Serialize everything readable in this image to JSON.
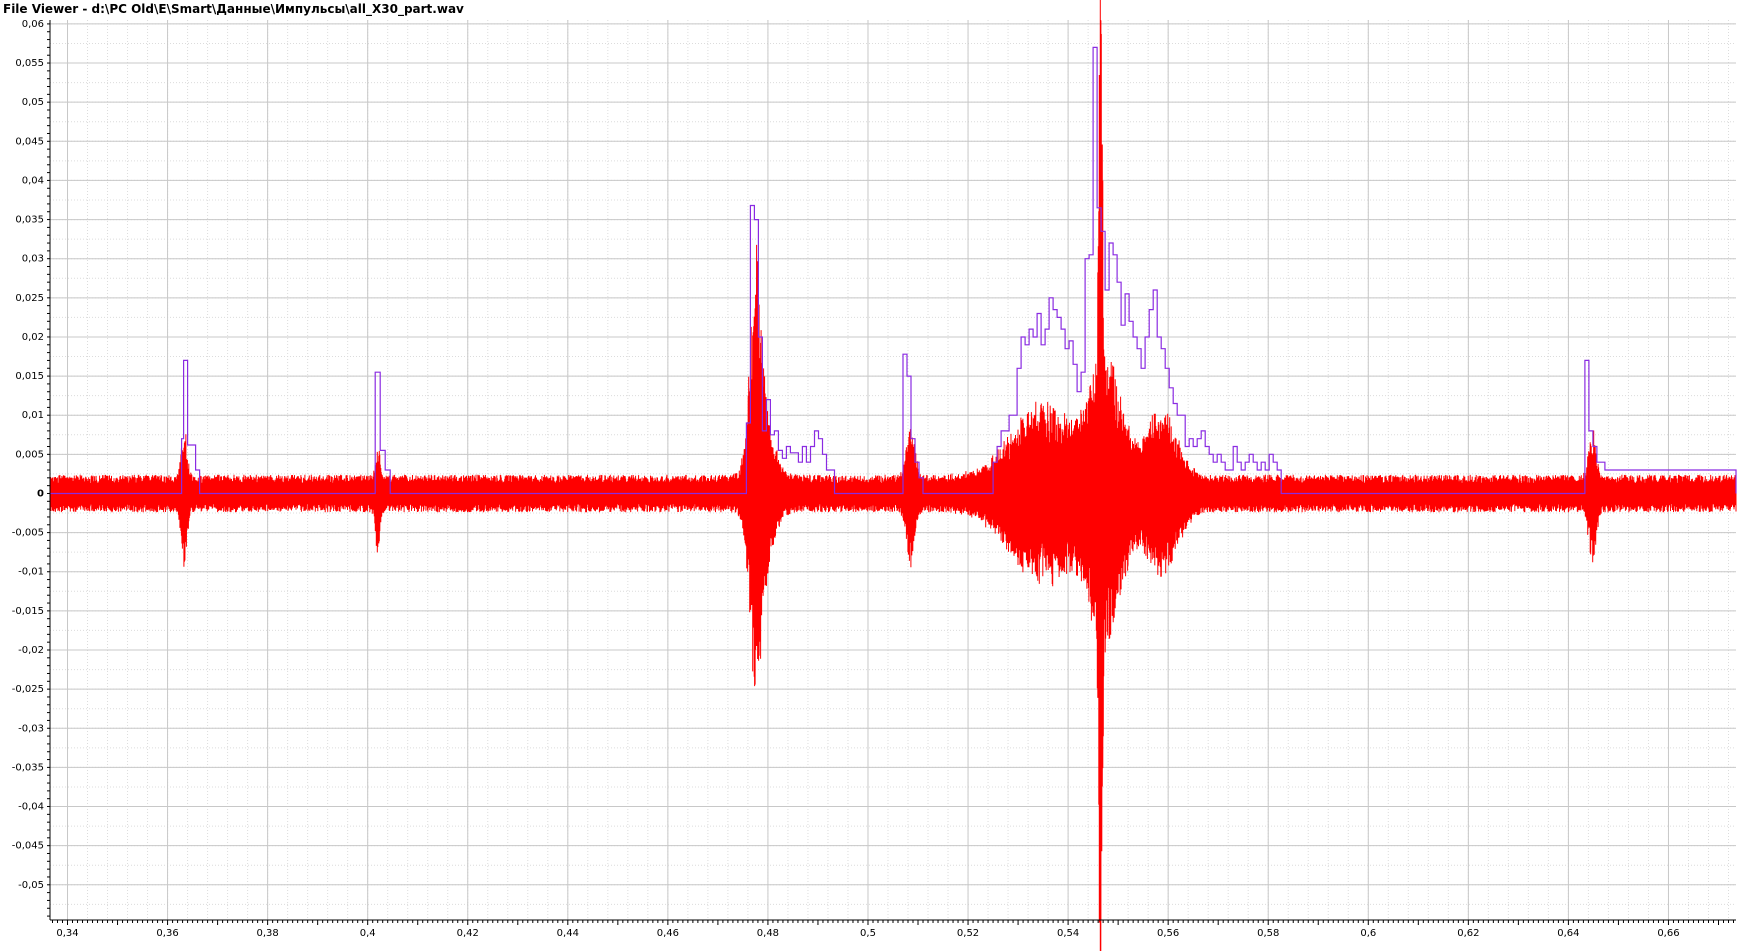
{
  "window": {
    "title": "File Viewer - d:\\PC Old\\E\\Smart\\Данные\\Импульсы\\all_X30_part.wav"
  },
  "colors": {
    "signal": "#ff0000",
    "envelope": "#8a2be2",
    "grid": "#c8c8c8",
    "axis": "#000000",
    "background": "#ffffff"
  },
  "chart_data": {
    "type": "line",
    "grid": true,
    "xlim": [
      0.3365,
      0.6735
    ],
    "ylim": [
      -0.0545,
      0.0605
    ],
    "x_ticks": [
      {
        "value": 0.34,
        "label": "0,34"
      },
      {
        "value": 0.36,
        "label": "0,36"
      },
      {
        "value": 0.38,
        "label": "0,38"
      },
      {
        "value": 0.4,
        "label": "0,4"
      },
      {
        "value": 0.42,
        "label": "0,42"
      },
      {
        "value": 0.44,
        "label": "0,44"
      },
      {
        "value": 0.46,
        "label": "0,46"
      },
      {
        "value": 0.48,
        "label": "0,48"
      },
      {
        "value": 0.5,
        "label": "0,5"
      },
      {
        "value": 0.52,
        "label": "0,52"
      },
      {
        "value": 0.54,
        "label": "0,54"
      },
      {
        "value": 0.56,
        "label": "0,56"
      },
      {
        "value": 0.58,
        "label": "0,58"
      },
      {
        "value": 0.6,
        "label": "0,6"
      },
      {
        "value": 0.62,
        "label": "0,62"
      },
      {
        "value": 0.64,
        "label": "0,64"
      },
      {
        "value": 0.66,
        "label": "0,66"
      }
    ],
    "y_ticks": [
      {
        "value": 0.06,
        "label": "0,06"
      },
      {
        "value": 0.055,
        "label": "0,055"
      },
      {
        "value": 0.05,
        "label": "0,05"
      },
      {
        "value": 0.045,
        "label": "0,045"
      },
      {
        "value": 0.04,
        "label": "0,04"
      },
      {
        "value": 0.035,
        "label": "0,035"
      },
      {
        "value": 0.03,
        "label": "0,03"
      },
      {
        "value": 0.025,
        "label": "0,025"
      },
      {
        "value": 0.02,
        "label": "0,02"
      },
      {
        "value": 0.015,
        "label": "0,015"
      },
      {
        "value": 0.01,
        "label": "0,01"
      },
      {
        "value": 0.005,
        "label": "0,005"
      },
      {
        "value": 0.0,
        "label": "0"
      },
      {
        "value": -0.005,
        "label": "-0,005"
      },
      {
        "value": -0.01,
        "label": "-0,01"
      },
      {
        "value": -0.015,
        "label": "-0,015"
      },
      {
        "value": -0.02,
        "label": "-0,02"
      },
      {
        "value": -0.025,
        "label": "-0,025"
      },
      {
        "value": -0.03,
        "label": "-0,03"
      },
      {
        "value": -0.035,
        "label": "-0,035"
      },
      {
        "value": -0.04,
        "label": "-0,04"
      },
      {
        "value": -0.045,
        "label": "-0,045"
      },
      {
        "value": -0.05,
        "label": "-0,05"
      }
    ],
    "series": [
      {
        "key": "envelope",
        "style": "step",
        "x": [
          0.3365,
          0.3628,
          0.3632,
          0.364,
          0.3648,
          0.3656,
          0.3664,
          0.4015,
          0.4025,
          0.4035,
          0.4045,
          0.4757,
          0.4765,
          0.4773,
          0.4781,
          0.4789,
          0.4797,
          0.4805,
          0.4813,
          0.4821,
          0.4829,
          0.4837,
          0.4845,
          0.4853,
          0.4861,
          0.4869,
          0.4877,
          0.4885,
          0.4893,
          0.4901,
          0.4909,
          0.4917,
          0.4925,
          0.4933,
          0.507,
          0.5078,
          0.5086,
          0.5094,
          0.5102,
          0.511,
          0.525,
          0.5258,
          0.5266,
          0.5274,
          0.5282,
          0.529,
          0.5298,
          0.5306,
          0.5314,
          0.5322,
          0.533,
          0.5338,
          0.5346,
          0.5354,
          0.5362,
          0.537,
          0.5378,
          0.5386,
          0.5394,
          0.5402,
          0.541,
          0.5418,
          0.5426,
          0.5434,
          0.5442,
          0.545,
          0.5458,
          0.5466,
          0.5474,
          0.5482,
          0.549,
          0.5498,
          0.5506,
          0.5514,
          0.5522,
          0.553,
          0.5538,
          0.5546,
          0.5554,
          0.5562,
          0.557,
          0.5578,
          0.5586,
          0.5594,
          0.5602,
          0.561,
          0.5618,
          0.5626,
          0.5634,
          0.5642,
          0.565,
          0.5658,
          0.5666,
          0.5674,
          0.5682,
          0.569,
          0.5698,
          0.5706,
          0.5714,
          0.5722,
          0.573,
          0.5738,
          0.5746,
          0.5754,
          0.5762,
          0.577,
          0.5778,
          0.5786,
          0.5794,
          0.5802,
          0.581,
          0.5818,
          0.5826,
          0.6433,
          0.6441,
          0.6449,
          0.6457,
          0.6465,
          0.6473,
          0.6735
        ],
        "y": [
          0.0,
          0.007,
          0.017,
          0.0062,
          0.0062,
          0.003,
          0.0,
          0.0155,
          0.0055,
          0.003,
          0.0,
          0.009,
          0.0368,
          0.035,
          0.02,
          0.008,
          0.012,
          0.0075,
          0.008,
          0.0055,
          0.0045,
          0.006,
          0.0052,
          0.0052,
          0.004,
          0.006,
          0.004,
          0.006,
          0.008,
          0.007,
          0.005,
          0.003,
          0.003,
          0.0,
          0.0178,
          0.015,
          0.007,
          0.004,
          0.002,
          0.0,
          0.004,
          0.006,
          0.008,
          0.008,
          0.01,
          0.01,
          0.016,
          0.02,
          0.019,
          0.021,
          0.02,
          0.023,
          0.019,
          0.021,
          0.025,
          0.0235,
          0.0225,
          0.021,
          0.0185,
          0.0195,
          0.0165,
          0.013,
          0.0155,
          0.03,
          0.0305,
          0.057,
          0.0365,
          0.0335,
          0.026,
          0.032,
          0.0305,
          0.027,
          0.0215,
          0.0255,
          0.022,
          0.02,
          0.0185,
          0.016,
          0.02,
          0.0235,
          0.026,
          0.02,
          0.0185,
          0.016,
          0.0135,
          0.0115,
          0.01,
          0.01,
          0.006,
          0.007,
          0.006,
          0.007,
          0.008,
          0.006,
          0.005,
          0.004,
          0.005,
          0.004,
          0.003,
          0.003,
          0.006,
          0.004,
          0.003,
          0.004,
          0.005,
          0.004,
          0.003,
          0.004,
          0.003,
          0.005,
          0.004,
          0.003,
          0.0,
          0.017,
          0.008,
          0.006,
          0.004,
          0.004,
          0.003,
          0.0
        ]
      },
      {
        "key": "signal",
        "style": "waveform",
        "noise_amplitude": 0.0024,
        "bursts": [
          {
            "x": 0.3633,
            "pos": 0.0065,
            "neg": 0.0075,
            "width": 0.0008
          },
          {
            "x": 0.402,
            "pos": 0.0045,
            "neg": 0.007,
            "width": 0.0006
          },
          {
            "x": 0.4775,
            "pos": 0.0235,
            "neg": 0.0185,
            "width": 0.0016
          },
          {
            "x": 0.479,
            "pos": 0.008,
            "neg": 0.008,
            "width": 0.003
          },
          {
            "x": 0.5085,
            "pos": 0.007,
            "neg": 0.0075,
            "width": 0.0012
          },
          {
            "x": 0.535,
            "pos": 0.01,
            "neg": 0.01,
            "width": 0.009
          },
          {
            "x": 0.5465,
            "pos": 0.057,
            "neg": 0.0545,
            "width": 0.0005
          },
          {
            "x": 0.5475,
            "pos": 0.016,
            "neg": 0.017,
            "width": 0.0045
          },
          {
            "x": 0.5585,
            "pos": 0.009,
            "neg": 0.009,
            "width": 0.0045
          },
          {
            "x": 0.6448,
            "pos": 0.0065,
            "neg": 0.0075,
            "width": 0.001
          }
        ]
      }
    ]
  }
}
